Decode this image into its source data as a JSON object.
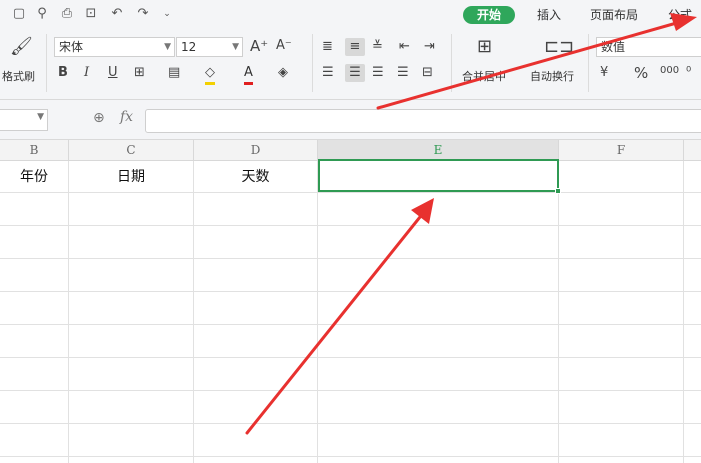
{
  "tabs": {
    "start": "开始",
    "insert": "插入",
    "page_layout": "页面布局",
    "formula": "公式"
  },
  "toolbar": {
    "format_painter": "格式刷",
    "font_name": "宋体",
    "font_size": "12",
    "merge_center": "合并居中",
    "wrap_text": "自动换行",
    "number_format": "数值",
    "percent_symbol": "%"
  },
  "formula_bar": {
    "fx_label": "fx"
  },
  "sheet": {
    "columns": [
      "B",
      "C",
      "D",
      "E",
      "F"
    ],
    "selected_column": "E",
    "row1": {
      "B": "年份",
      "C": "日期",
      "D": "天数"
    }
  },
  "colors": {
    "accent": "#2fa75b",
    "arrow": "#e8312f"
  }
}
